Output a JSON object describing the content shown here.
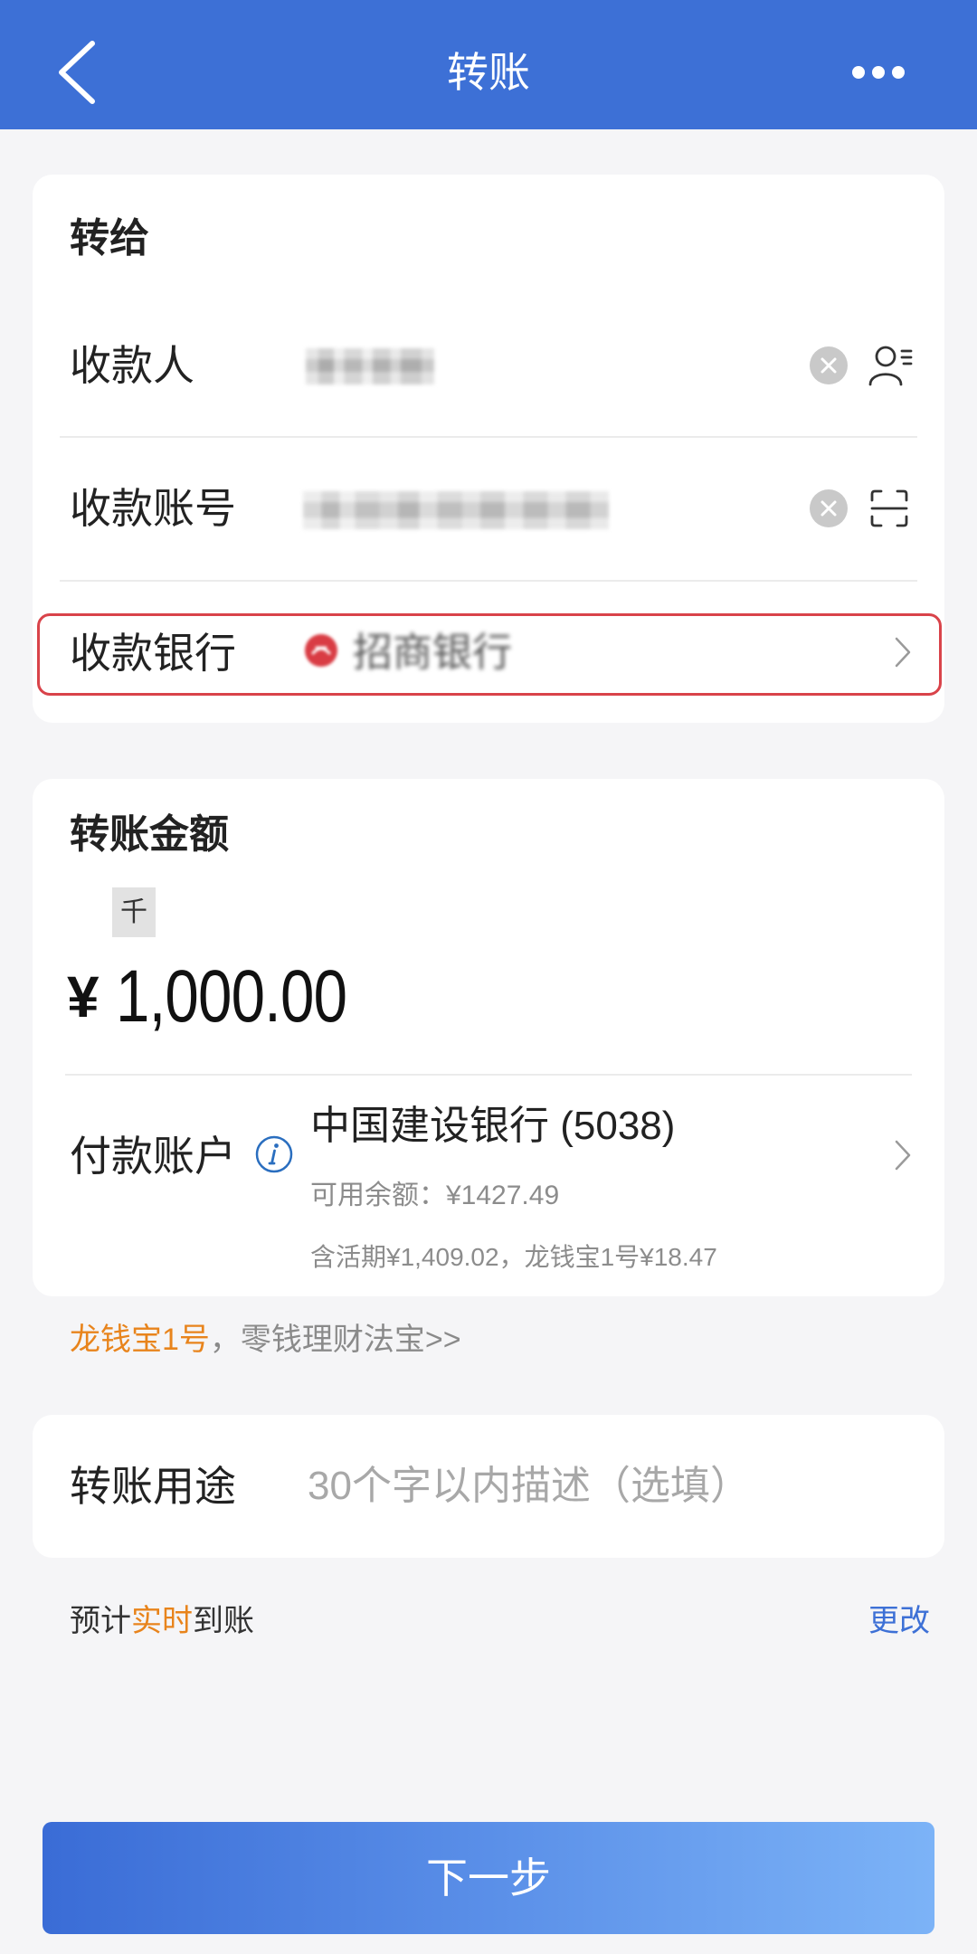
{
  "header": {
    "title": "转账"
  },
  "recipient_card": {
    "heading": "转给",
    "payee_label": "收款人",
    "account_label": "收款账号",
    "bank_label": "收款银行",
    "bank_name": "招商银行"
  },
  "amount_card": {
    "heading": "转账金额",
    "unit_badge": "千",
    "currency": "¥",
    "amount": "1,000.00",
    "payer_label": "付款账户",
    "payer_bank": "中国建设银行 (5038)",
    "available_balance": "可用余额：¥1427.49",
    "balance_breakdown": "含活期¥1,409.02，龙钱宝1号¥18.47"
  },
  "promo": {
    "highlight": "龙钱宝1号",
    "text": "，零钱理财法宝>>"
  },
  "purpose_card": {
    "label": "转账用途",
    "placeholder": "30个字以内描述（选填）"
  },
  "arrival": {
    "prefix": "预计",
    "highlight": "实时",
    "suffix": "到账",
    "change_link": "更改"
  },
  "next_button": {
    "label": "下一步"
  },
  "icons": {
    "back": "chevron-left-icon",
    "more": "more-dots-icon",
    "clear": "clear-icon",
    "contacts": "contact-book-icon",
    "scan": "scan-icon",
    "bank_logo": "bank-logo-icon",
    "info": "info-icon",
    "chevron": "chevron-right-icon"
  },
  "colors": {
    "header": "#3d70d6",
    "accent_orange": "#e8841c",
    "highlight_red": "#d9434a",
    "link_blue": "#3d70d6",
    "button_gradient_start": "#3a6cd6",
    "button_gradient_end": "#7cb3f7"
  }
}
